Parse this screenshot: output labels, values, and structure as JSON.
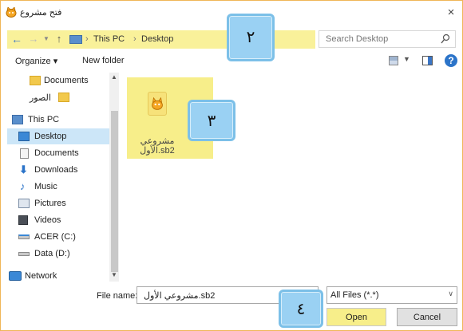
{
  "window": {
    "title": "فتح مشروع",
    "close_glyph": "×",
    "accent_color": "#f0b657",
    "highlight_color": "#f7ee8a",
    "callout_color": "#9ad1f3"
  },
  "nav": {
    "back_icon": "arrow-left-icon",
    "forward_icon": "arrow-right-icon",
    "up_icon": "arrow-up-icon",
    "breadcrumb": [
      "This PC",
      "Desktop"
    ],
    "search_placeholder": "Search Desktop"
  },
  "toolbar": {
    "organize_label": "Organize ▾",
    "new_folder_label": "New folder"
  },
  "sidebar": {
    "items": [
      {
        "label": "Documents",
        "icon": "folder-icon"
      },
      {
        "label": "الصور",
        "icon": "folder-icon"
      },
      {
        "label": "This PC",
        "icon": "computer-icon"
      },
      {
        "label": "Desktop",
        "icon": "desktop-icon",
        "selected": true
      },
      {
        "label": "Documents",
        "icon": "documents-icon"
      },
      {
        "label": "Downloads",
        "icon": "download-icon"
      },
      {
        "label": "Music",
        "icon": "music-icon"
      },
      {
        "label": "Pictures",
        "icon": "pictures-icon"
      },
      {
        "label": "Videos",
        "icon": "videos-icon"
      },
      {
        "label": "ACER (C:)",
        "icon": "drive-icon"
      },
      {
        "label": "Data (D:)",
        "icon": "drive-icon"
      },
      {
        "label": "Network",
        "icon": "network-icon"
      }
    ]
  },
  "content": {
    "file": {
      "name_line1": "مشروعي",
      "name_line2": "الأول.sb2",
      "icon": "scratch-project-icon"
    }
  },
  "callouts": {
    "c2": "٢",
    "c3": "٣",
    "c4": "٤"
  },
  "footer": {
    "filename_label": "File name:",
    "filename_value": "مشروعي الأول.sb2",
    "filetype_value": "All Files (*.*)",
    "open_label": "Open",
    "cancel_label": "Cancel"
  }
}
